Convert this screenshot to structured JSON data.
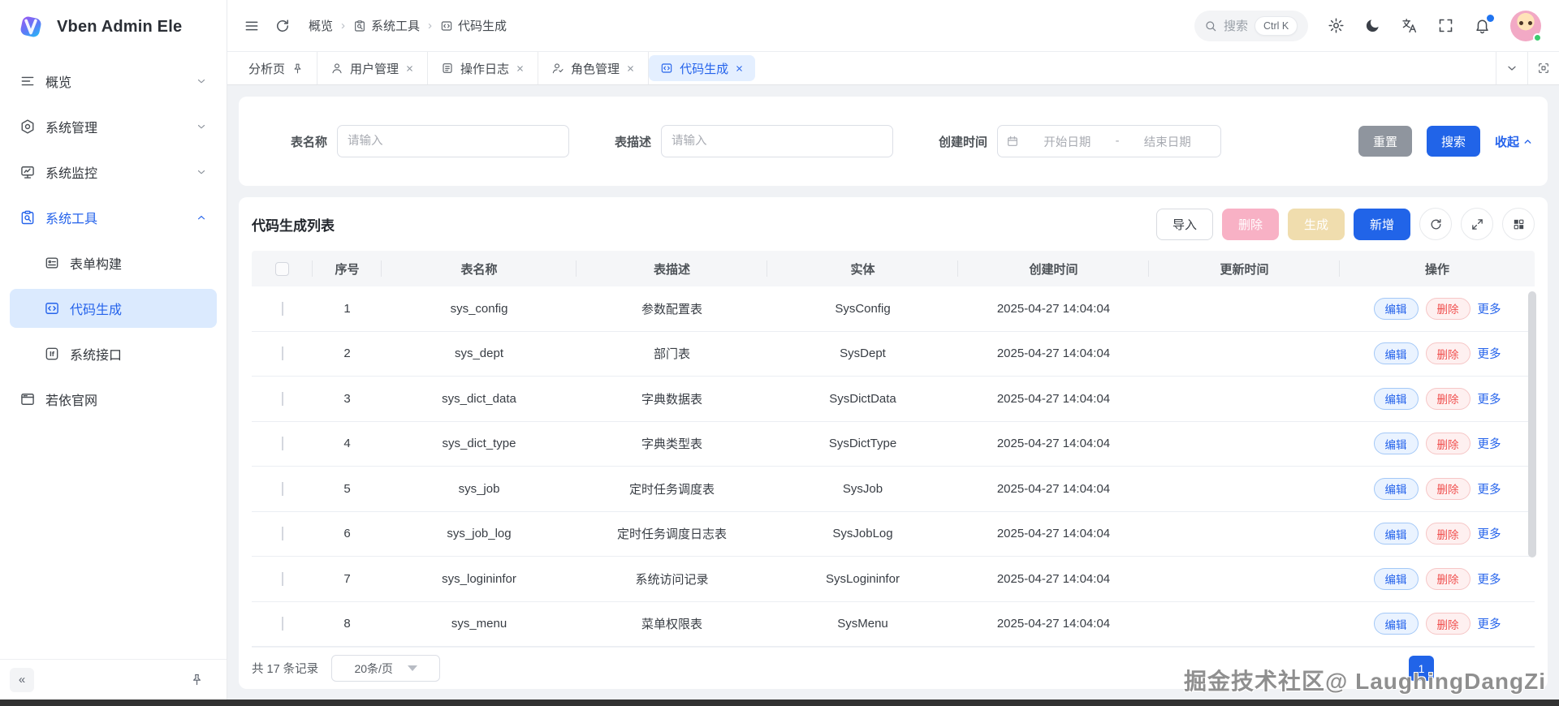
{
  "app": {
    "title": "Vben Admin Ele"
  },
  "header": {
    "breadcrumb": [
      {
        "label": "概览",
        "icon": null
      },
      {
        "label": "系统工具",
        "icon": "tool"
      },
      {
        "label": "代码生成",
        "icon": "code"
      }
    ],
    "search_placeholder": "搜索",
    "search_shortcut": "Ctrl K"
  },
  "tabbar": {
    "tabs": [
      {
        "label": "分析页",
        "icon": null,
        "pinned": true,
        "closable": false,
        "active": false
      },
      {
        "label": "用户管理",
        "icon": "person",
        "pinned": false,
        "closable": true,
        "active": false
      },
      {
        "label": "操作日志",
        "icon": "log",
        "pinned": false,
        "closable": true,
        "active": false
      },
      {
        "label": "角色管理",
        "icon": "role",
        "pinned": false,
        "closable": true,
        "active": false
      },
      {
        "label": "代码生成",
        "icon": "code",
        "pinned": false,
        "closable": true,
        "active": true
      }
    ]
  },
  "sidebar": {
    "menu": [
      {
        "label": "概览",
        "icon": "overview",
        "chevron": "down",
        "level": 1,
        "active": false,
        "expanded": false
      },
      {
        "label": "系统管理",
        "icon": "admin",
        "chevron": "down",
        "level": 1,
        "active": false,
        "expanded": false
      },
      {
        "label": "系统监控",
        "icon": "monitor",
        "chevron": "down",
        "level": 1,
        "active": false,
        "expanded": false
      },
      {
        "label": "系统工具",
        "icon": "tool",
        "chevron": "up",
        "level": 1,
        "active": false,
        "expanded": true
      },
      {
        "label": "表单构建",
        "icon": "form",
        "chevron": null,
        "level": 2,
        "active": false,
        "expanded": false
      },
      {
        "label": "代码生成",
        "icon": "code",
        "chevron": null,
        "level": 2,
        "active": true,
        "expanded": false
      },
      {
        "label": "系统接口",
        "icon": "if",
        "chevron": null,
        "level": 2,
        "active": false,
        "expanded": false
      },
      {
        "label": "若依官网",
        "icon": "website",
        "chevron": null,
        "level": 1,
        "active": false,
        "expanded": false
      }
    ]
  },
  "filter": {
    "name_label": "表名称",
    "name_placeholder": "请输入",
    "desc_label": "表描述",
    "desc_placeholder": "请输入",
    "date_label": "创建时间",
    "date_start": "开始日期",
    "date_separator": "-",
    "date_end": "结束日期",
    "reset_label": "重置",
    "search_label": "搜索",
    "collapse_label": "收起"
  },
  "list": {
    "title": "代码生成列表",
    "toolbar": {
      "import_label": "导入",
      "delete_label": "删除",
      "generate_label": "生成",
      "add_label": "新增"
    },
    "columns": [
      "序号",
      "表名称",
      "表描述",
      "实体",
      "创建时间",
      "更新时间",
      "操作"
    ],
    "rows": [
      {
        "no": "1",
        "table": "sys_config",
        "desc": "参数配置表",
        "entity": "SysConfig",
        "created": "2025-04-27 14:04:04",
        "updated": ""
      },
      {
        "no": "2",
        "table": "sys_dept",
        "desc": "部门表",
        "entity": "SysDept",
        "created": "2025-04-27 14:04:04",
        "updated": ""
      },
      {
        "no": "3",
        "table": "sys_dict_data",
        "desc": "字典数据表",
        "entity": "SysDictData",
        "created": "2025-04-27 14:04:04",
        "updated": ""
      },
      {
        "no": "4",
        "table": "sys_dict_type",
        "desc": "字典类型表",
        "entity": "SysDictType",
        "created": "2025-04-27 14:04:04",
        "updated": ""
      },
      {
        "no": "5",
        "table": "sys_job",
        "desc": "定时任务调度表",
        "entity": "SysJob",
        "created": "2025-04-27 14:04:04",
        "updated": ""
      },
      {
        "no": "6",
        "table": "sys_job_log",
        "desc": "定时任务调度日志表",
        "entity": "SysJobLog",
        "created": "2025-04-27 14:04:04",
        "updated": ""
      },
      {
        "no": "7",
        "table": "sys_logininfor",
        "desc": "系统访问记录",
        "entity": "SysLogininfor",
        "created": "2025-04-27 14:04:04",
        "updated": ""
      },
      {
        "no": "8",
        "table": "sys_menu",
        "desc": "菜单权限表",
        "entity": "SysMenu",
        "created": "2025-04-27 14:04:04",
        "updated": ""
      }
    ],
    "row_actions": {
      "edit_label": "编辑",
      "delete_label": "删除",
      "more_label": "更多"
    },
    "footer": {
      "total": "共 17 条记录",
      "page_size": "20条/页",
      "current_page": "1"
    }
  },
  "watermark": "掘金技术社区@ LaughingDangZi",
  "colors": {
    "primary": "#2164e8",
    "active_tab_bg": "#e4efff",
    "sidebar_active_bg": "#dbeafe",
    "delete_disabled_bg": "#f8b1c5",
    "generate_disabled_bg": "#f0ddae",
    "danger": "#f0504f"
  }
}
